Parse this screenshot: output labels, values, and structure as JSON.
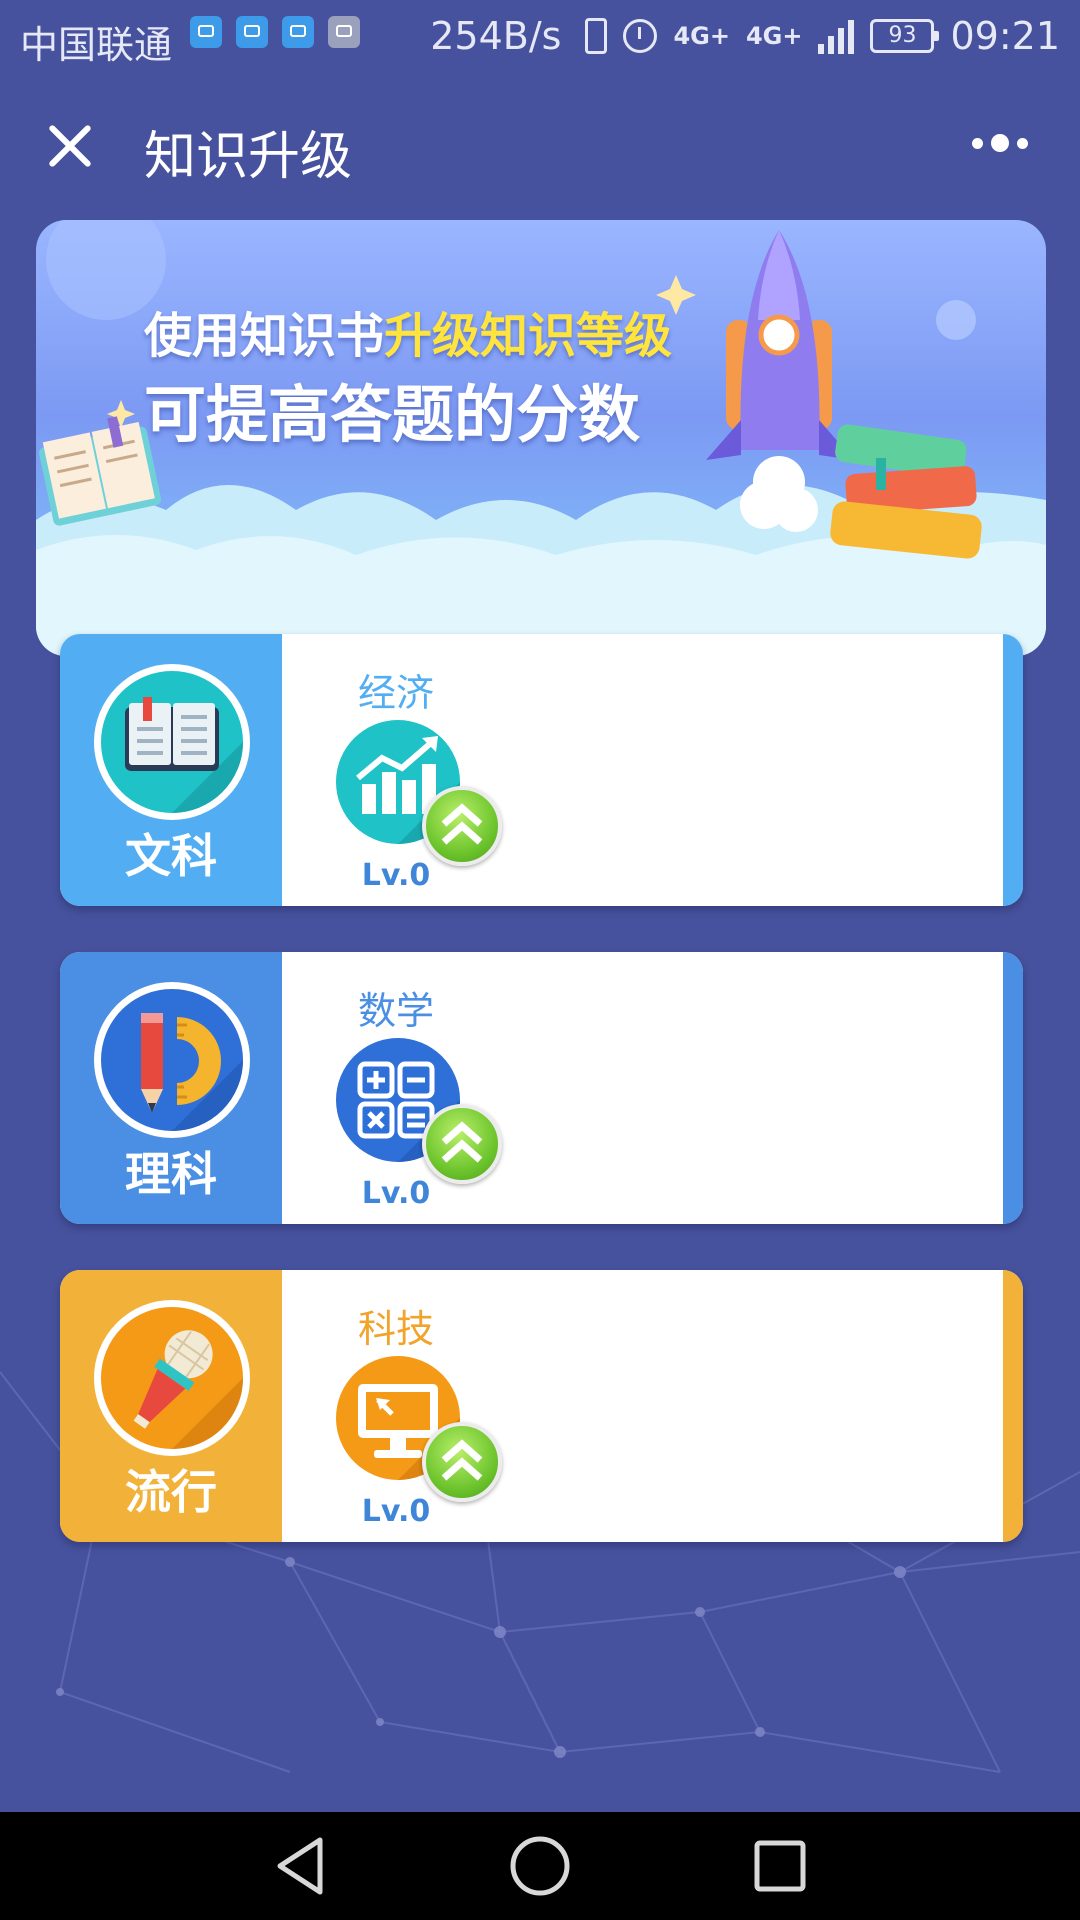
{
  "status_bar": {
    "carrier": "中国联通",
    "net_speed": "254B/s",
    "network_label_1": "4G+",
    "network_label_2": "4G+",
    "battery": "93",
    "time": "09:21"
  },
  "header": {
    "title": "知识升级"
  },
  "banner": {
    "line1_prefix": "使用知识书",
    "line1_highlight": "升级知识等级",
    "line2": "可提高答题的分数"
  },
  "categories": [
    {
      "label": "文科",
      "icon": "book-icon",
      "side_color": "#52adf3",
      "strip_color": "#52adf3",
      "subject": {
        "name": "经济",
        "name_color": "#52adf3",
        "icon": "chart-icon",
        "level": "Lv.0"
      }
    },
    {
      "label": "理科",
      "icon": "pencil-ruler-icon",
      "side_color": "#4a8fe3",
      "strip_color": "#4a8fe3",
      "subject": {
        "name": "数学",
        "name_color": "#4a8fe3",
        "icon": "calculator-icon",
        "level": "Lv.0"
      }
    },
    {
      "label": "流行",
      "icon": "microphone-icon",
      "side_color": "#f2b23a",
      "strip_color": "#f2b23a",
      "subject": {
        "name": "科技",
        "name_color": "#f2a32b",
        "icon": "computer-icon",
        "level": "Lv.0"
      }
    }
  ]
}
